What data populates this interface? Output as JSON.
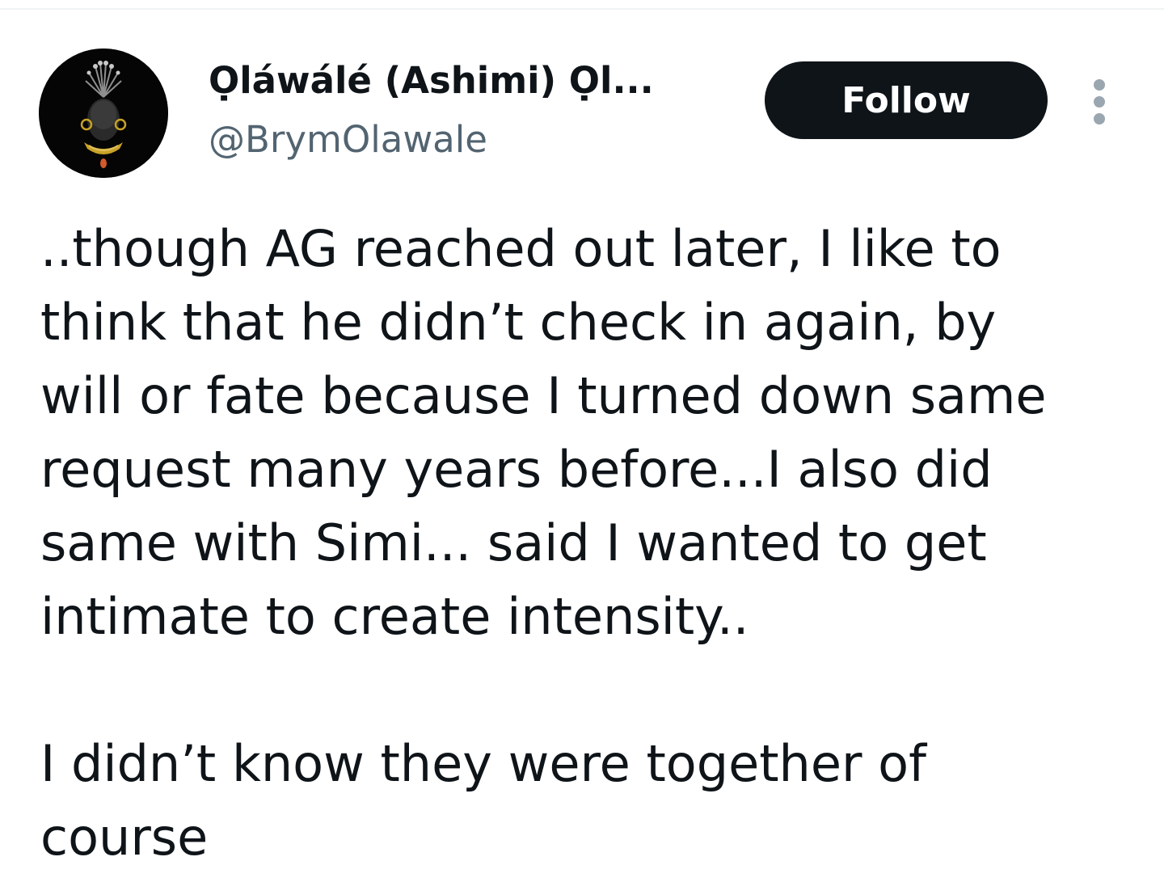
{
  "author": {
    "display_name": "Ọláwálé (Ashimi) Ọl...",
    "handle": "@BrymOlawale"
  },
  "actions": {
    "follow_label": "Follow",
    "more_icon": "more-vertical-icon"
  },
  "tweet": {
    "paragraph1": [
      "..though AG reached out later, I like to",
      "think that he didn’t check in again, by",
      "will or fate because I turned down same",
      "request many years before...I also did",
      "same with Simi... said I wanted to get",
      "intimate to create intensity.."
    ],
    "paragraph2": [
      "I didn’t know they were together of",
      "course"
    ]
  },
  "colors": {
    "text_primary": "#0f1419",
    "text_secondary": "#536471",
    "follow_bg": "#0f1419",
    "divider": "#eff3f4"
  }
}
